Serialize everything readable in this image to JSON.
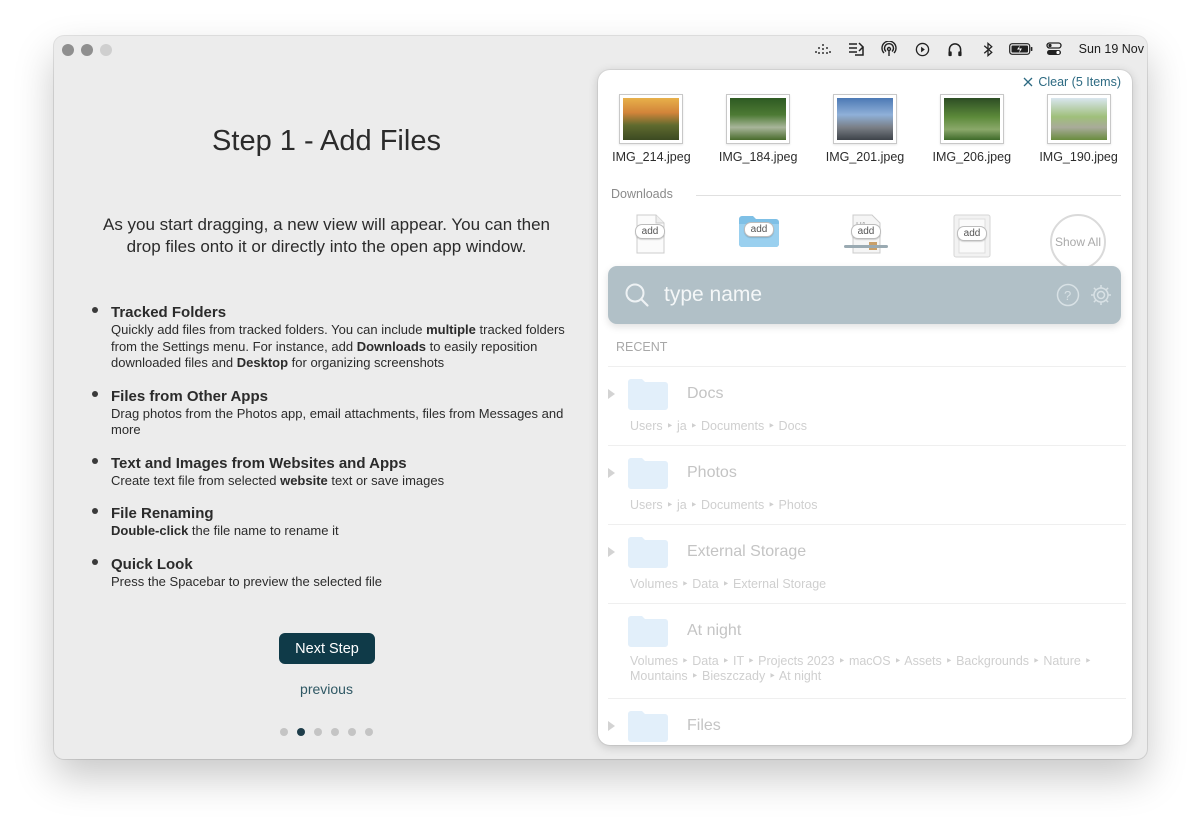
{
  "menubar": {
    "icons": [
      "wifi-dots-icon",
      "file-stack-icon",
      "airdrop-icon",
      "play-circle-icon",
      "headphones-icon",
      "bluetooth-icon",
      "battery-icon",
      "control-center-icon"
    ],
    "clock": "Sun 19 Nov"
  },
  "onboarding": {
    "title": "Step 1 - Add Files",
    "intro": "As you start dragging, a new view will appear. You can then drop files onto it or directly into the open app window.",
    "features": [
      {
        "title": "Tracked Folders",
        "p1": "Quickly add files from tracked folders. You can include ",
        "b1": "multiple",
        "p2": " tracked folders from the Settings menu. For instance, add ",
        "b2": "Downloads",
        "p3": " to easily reposition downloaded files and ",
        "b3": "Desktop",
        "p4": " for organizing screenshots"
      },
      {
        "title": "Files from Other Apps",
        "desc": "Drag photos from the Photos app, email attachments, files from Messages and more"
      },
      {
        "title": "Text and Images from Websites and Apps",
        "p1": "Create text file from selected ",
        "b1": "website",
        "p2": " text or save images"
      },
      {
        "title": "File Renaming",
        "b1": "Double-click",
        "p2": " the file name to rename it"
      },
      {
        "title": "Quick Look",
        "desc": "Press the Spacebar to preview the selected file"
      }
    ],
    "next_label": "Next Step",
    "previous_label": "previous",
    "pager": {
      "count": 6,
      "active": 1
    }
  },
  "panel": {
    "clear_label": "Clear (5 Items)",
    "files": [
      {
        "name": "IMG_214.jpeg"
      },
      {
        "name": "IMG_184.jpeg"
      },
      {
        "name": "IMG_201.jpeg"
      },
      {
        "name": "IMG_206.jpeg"
      },
      {
        "name": "IMG_190.jpeg"
      }
    ],
    "downloads_label": "Downloads",
    "add_label": "add",
    "show_all_label": "Show All",
    "search_placeholder": "type name",
    "recent_label": "RECENT",
    "recent": [
      {
        "title": "Docs",
        "path": "Users ‣ ja ‣ Documents ‣ Docs"
      },
      {
        "title": "Photos",
        "path": "Users ‣ ja ‣ Documents ‣ Photos"
      },
      {
        "title": "External Storage",
        "path": "Volumes ‣ Data ‣ External Storage"
      },
      {
        "title": "At night",
        "path": "Volumes ‣ Data ‣ IT ‣ Projects 2023 ‣ macOS ‣ Assets ‣ Backgrounds ‣ Nature ‣ Mountains ‣ Bieszczady ‣ At night"
      },
      {
        "title": "Files",
        "path": ""
      }
    ]
  }
}
